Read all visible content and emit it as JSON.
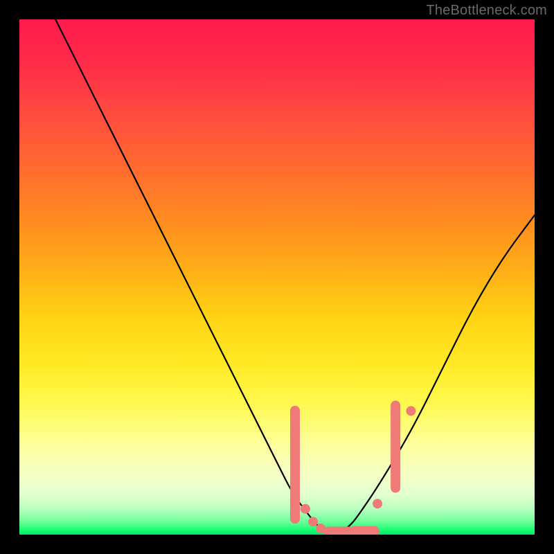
{
  "watermark": "TheBottleneck.com",
  "chart_data": {
    "type": "line",
    "title": "",
    "xlabel": "",
    "ylabel": "",
    "xlim": [
      0,
      100
    ],
    "ylim": [
      0,
      100
    ],
    "grid": false,
    "legend": false,
    "series": [
      {
        "name": "bottleneck-curve",
        "color": "#000000",
        "x": [
          7,
          12,
          18,
          24,
          30,
          36,
          42,
          47,
          50,
          53,
          56,
          58,
          60,
          62,
          64,
          66,
          70,
          76,
          82,
          88,
          94,
          100
        ],
        "y": [
          100,
          90,
          78,
          66,
          54,
          42,
          30,
          20,
          14,
          8,
          4,
          1.5,
          0.5,
          0.5,
          1.5,
          4,
          10,
          20,
          32,
          44,
          54,
          62
        ]
      }
    ],
    "markers": [
      {
        "name": "left-band-marker",
        "shape": "rounded-bar",
        "color": "#ef7a78",
        "x": 53.5,
        "y_from": 4,
        "y_to": 25
      },
      {
        "name": "left-dot-1",
        "shape": "dot",
        "color": "#ef7a78",
        "x": 55.5,
        "y": 5
      },
      {
        "name": "left-dot-2",
        "shape": "dot",
        "color": "#ef7a78",
        "x": 57.0,
        "y": 2.5
      },
      {
        "name": "left-dot-3",
        "shape": "dot",
        "color": "#ef7a78",
        "x": 58.5,
        "y": 1.2
      },
      {
        "name": "bottom-band-1",
        "shape": "rounded-bar",
        "color": "#ef7a78",
        "x_from": 59,
        "x_to": 63,
        "y": 0.6
      },
      {
        "name": "bottom-dot-1",
        "shape": "dot",
        "color": "#ef7a78",
        "x": 63.5,
        "y": 0.6
      },
      {
        "name": "bottom-band-2",
        "shape": "rounded-bar",
        "color": "#ef7a78",
        "x_from": 64,
        "x_to": 68,
        "y": 0.7
      },
      {
        "name": "right-dot-1",
        "shape": "dot",
        "color": "#ef7a78",
        "x": 69.5,
        "y": 6
      },
      {
        "name": "right-band-marker",
        "shape": "rounded-bar",
        "color": "#ef7a78",
        "x": 73.0,
        "y_from": 10,
        "y_to": 26
      },
      {
        "name": "right-dot-2",
        "shape": "dot",
        "color": "#ef7a78",
        "x": 76.0,
        "y": 24
      }
    ],
    "background_gradient": {
      "direction": "top-to-bottom",
      "stops": [
        {
          "pos": 0.0,
          "color": "#ff1a4d"
        },
        {
          "pos": 0.3,
          "color": "#ff6e2e"
        },
        {
          "pos": 0.58,
          "color": "#ffd313"
        },
        {
          "pos": 0.82,
          "color": "#feff97"
        },
        {
          "pos": 0.95,
          "color": "#baffc0"
        },
        {
          "pos": 1.0,
          "color": "#00e765"
        }
      ]
    }
  }
}
